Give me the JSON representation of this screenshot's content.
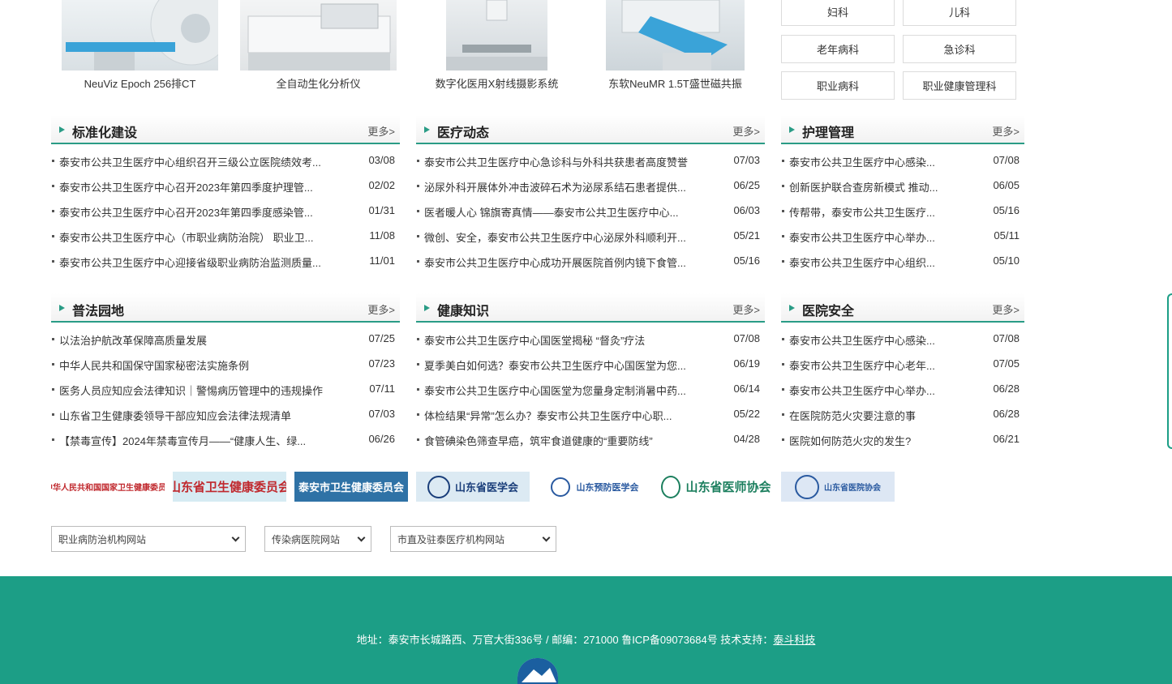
{
  "equipment": [
    {
      "caption": "NeuViz Epoch 256排CT"
    },
    {
      "caption": "全自动生化分析仪"
    },
    {
      "caption": "数字化医用X射线摄影系统"
    },
    {
      "caption": "东软NeuMR 1.5T盛世磁共振"
    }
  ],
  "departments": [
    "妇科",
    "儿科",
    "老年病科",
    "急诊科",
    "职业病科",
    "职业健康管理科"
  ],
  "more_label": "更多>",
  "boxes": [
    {
      "title": "标准化建设",
      "items": [
        {
          "t": "泰安市公共卫生医疗中心组织召开三级公立医院绩效考...",
          "d": "03/08"
        },
        {
          "t": "泰安市公共卫生医疗中心召开2023年第四季度护理管...",
          "d": "02/02"
        },
        {
          "t": "泰安市公共卫生医疗中心召开2023年第四季度感染管...",
          "d": "01/31"
        },
        {
          "t": "泰安市公共卫生医疗中心（市职业病防治院） 职业卫...",
          "d": "11/08"
        },
        {
          "t": "泰安市公共卫生医疗中心迎接省级职业病防治监测质量...",
          "d": "11/01"
        }
      ]
    },
    {
      "title": "医疗动态",
      "items": [
        {
          "t": "泰安市公共卫生医疗中心急诊科与外科共获患者高度赞誉",
          "d": "07/03"
        },
        {
          "t": "泌尿外科开展体外冲击波碎石术为泌尿系结石患者提供...",
          "d": "06/25"
        },
        {
          "t": "医者暖人心 锦旗寄真情——泰安市公共卫生医疗中心...",
          "d": "06/03"
        },
        {
          "t": "微创、安全，泰安市公共卫生医疗中心泌尿外科顺利开...",
          "d": "05/21"
        },
        {
          "t": "泰安市公共卫生医疗中心成功开展医院首例内镜下食管...",
          "d": "05/16"
        }
      ]
    },
    {
      "title": "护理管理",
      "items": [
        {
          "t": "泰安市公共卫生医疗中心感染...",
          "d": "07/08"
        },
        {
          "t": "创新医护联合查房新模式 推动...",
          "d": "06/05"
        },
        {
          "t": "传帮带，泰安市公共卫生医疗...",
          "d": "05/16"
        },
        {
          "t": "泰安市公共卫生医疗中心举办...",
          "d": "05/11"
        },
        {
          "t": "泰安市公共卫生医疗中心组织...",
          "d": "05/10"
        }
      ]
    },
    {
      "title": "普法园地",
      "items": [
        {
          "t": "以法治护航改革保障高质量发展",
          "d": "07/25"
        },
        {
          "t": "中华人民共和国保守国家秘密法实施条例",
          "d": "07/23"
        },
        {
          "t": "医务人员应知应会法律知识｜警惕病历管理中的违规操作",
          "d": "07/11"
        },
        {
          "t": "山东省卫生健康委领导干部应知应会法律法规清单",
          "d": "07/03"
        },
        {
          "t": "【禁毒宣传】2024年禁毒宣传月——“健康人生、绿...",
          "d": "06/26"
        }
      ]
    },
    {
      "title": "健康知识",
      "items": [
        {
          "t": "泰安市公共卫生医疗中心国医堂揭秘 “督灸”疗法",
          "d": "07/08"
        },
        {
          "t": "夏季美白如何选？泰安市公共卫生医疗中心国医堂为您...",
          "d": "06/19"
        },
        {
          "t": "泰安市公共卫生医疗中心国医堂为您量身定制消暑中药...",
          "d": "06/14"
        },
        {
          "t": "体检结果“异常”怎么办？泰安市公共卫生医疗中心职...",
          "d": "05/22"
        },
        {
          "t": "食管碘染色筛查早癌，筑牢食道健康的“重要防线”",
          "d": "04/28"
        }
      ]
    },
    {
      "title": "医院安全",
      "items": [
        {
          "t": "泰安市公共卫生医疗中心感染...",
          "d": "07/08"
        },
        {
          "t": "泰安市公共卫生医疗中心老年...",
          "d": "07/05"
        },
        {
          "t": "泰安市公共卫生医疗中心举办...",
          "d": "06/28"
        },
        {
          "t": "在医院防范火灾要注意的事",
          "d": "06/28"
        },
        {
          "t": "医院如何防范火灾的发生?",
          "d": "06/21"
        }
      ]
    }
  ],
  "partners": [
    {
      "name": "中华人民共和国国家卫生健康委员会",
      "color": "#c0282d"
    },
    {
      "name": "山东省卫生健康委员会",
      "color": "#c0282d"
    },
    {
      "name": "泰安市卫生健康委员会",
      "color": "#ffffff"
    },
    {
      "name": "山东省医学会",
      "color": "#1a3e7a"
    },
    {
      "name": "山东预防医学会",
      "color": "#2a5aa0"
    },
    {
      "name": "山东省医师协会",
      "color": "#1c7f5e"
    },
    {
      "name": "山东省医院协会",
      "color": "#2a5aa0"
    }
  ],
  "selects": [
    "职业病防治机构网站",
    "传染病医院网站",
    "市直及驻泰医疗机构网站"
  ],
  "footer": {
    "address": "地址：泰安市长城路西、万官大街336号 / 邮编：271000 鲁ICP备09073684号 技术支持：",
    "support_link": "泰斗科技"
  },
  "colors": {
    "accent": "#1c9e86"
  }
}
